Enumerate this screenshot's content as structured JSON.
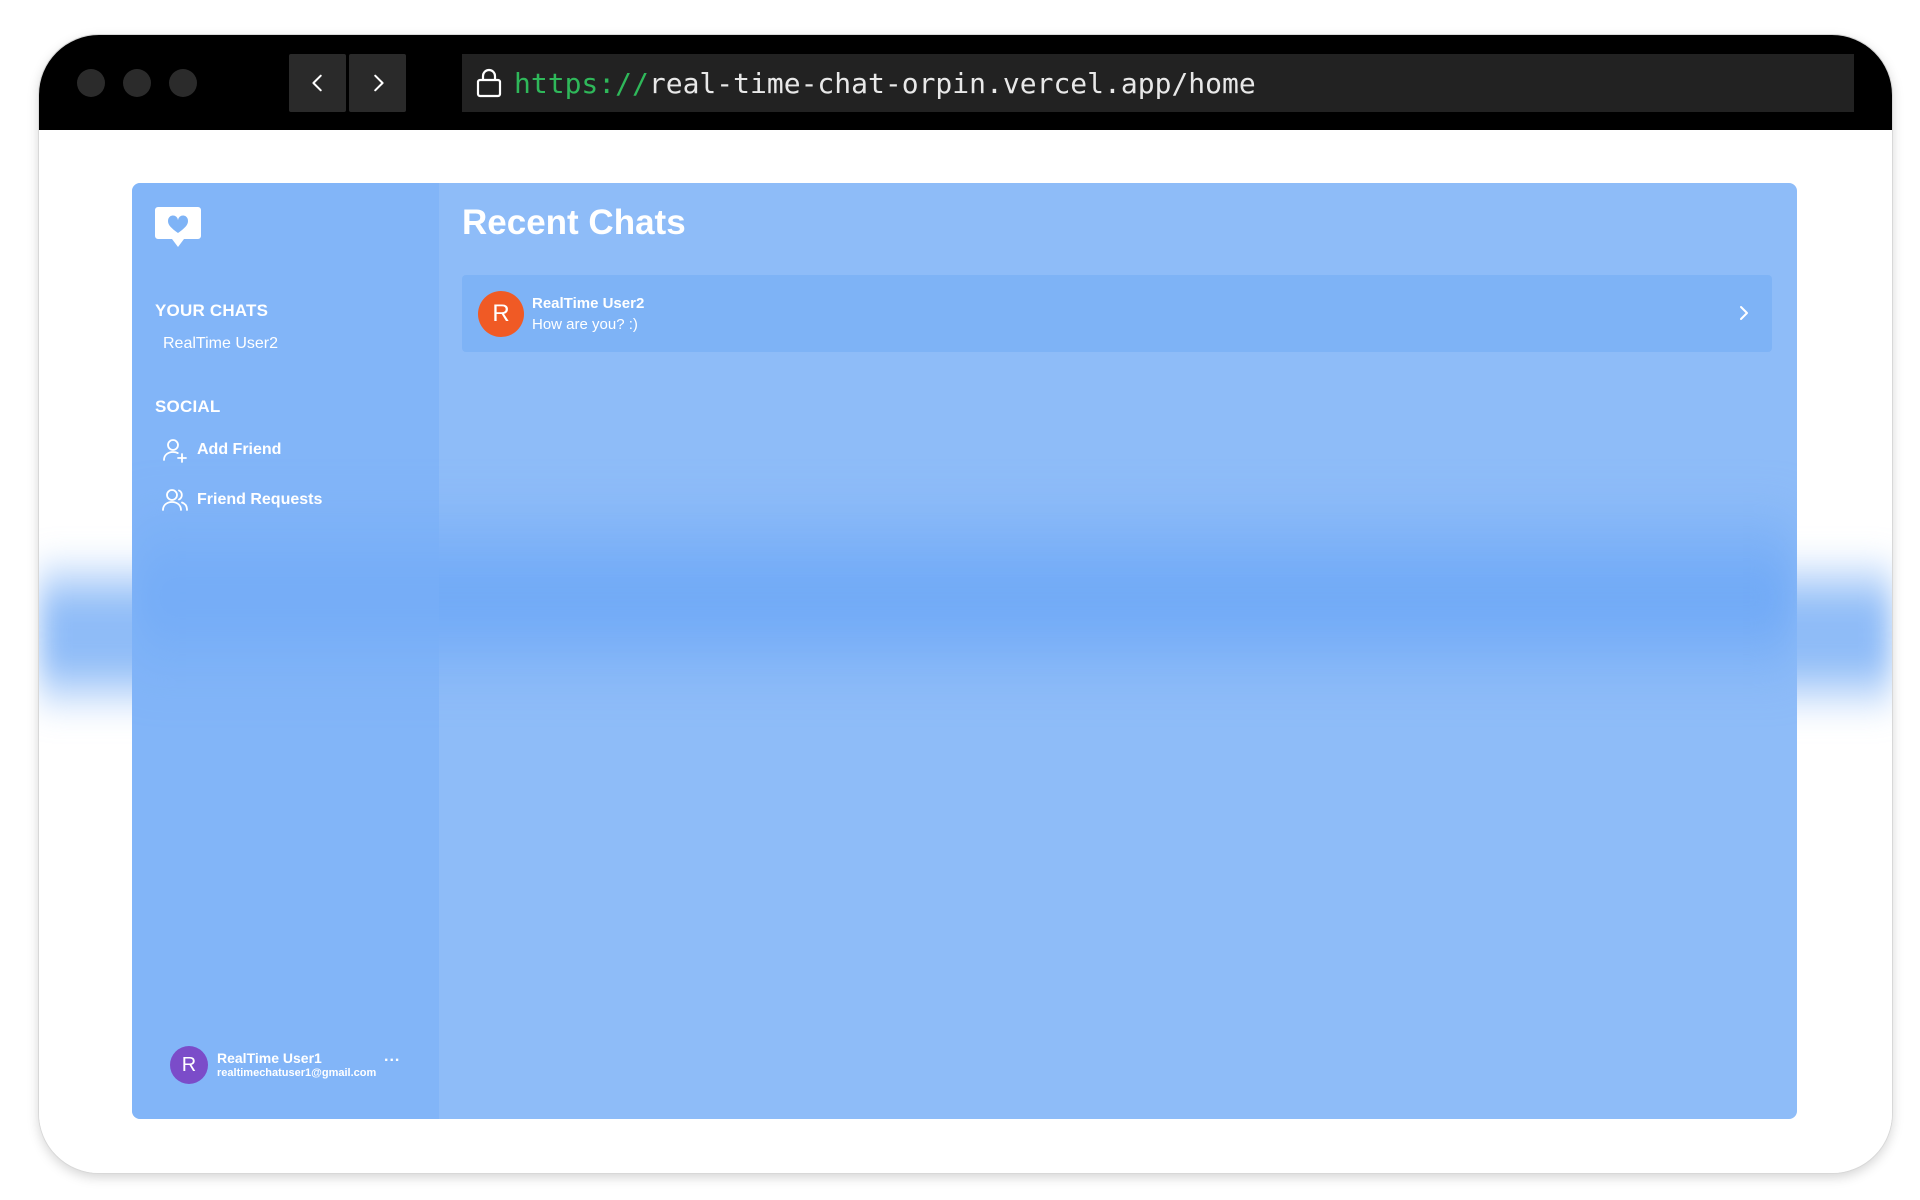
{
  "browser": {
    "url_protocol": "https://",
    "url_rest": "real-time-chat-orpin.vercel.app/home"
  },
  "sidebar": {
    "your_chats_title": "YOUR CHATS",
    "chats": [
      "RealTime User2"
    ],
    "social_title": "SOCIAL",
    "add_friend_label": "Add Friend",
    "friend_requests_label": "Friend Requests"
  },
  "profile": {
    "avatar_letter": "R",
    "name": "RealTime User1",
    "email": "realtimechatuser1@gmail.com",
    "more_label": "..."
  },
  "main": {
    "title": "Recent Chats",
    "recent_chats": [
      {
        "avatar_letter": "R",
        "name": "RealTime User2",
        "last_message": "How are you? :)"
      }
    ]
  },
  "colors": {
    "app_background": "#8ebcf8",
    "chat_avatar": "#f05a25",
    "profile_avatar": "#7b4cc9",
    "url_protocol": "#2fb85a"
  }
}
